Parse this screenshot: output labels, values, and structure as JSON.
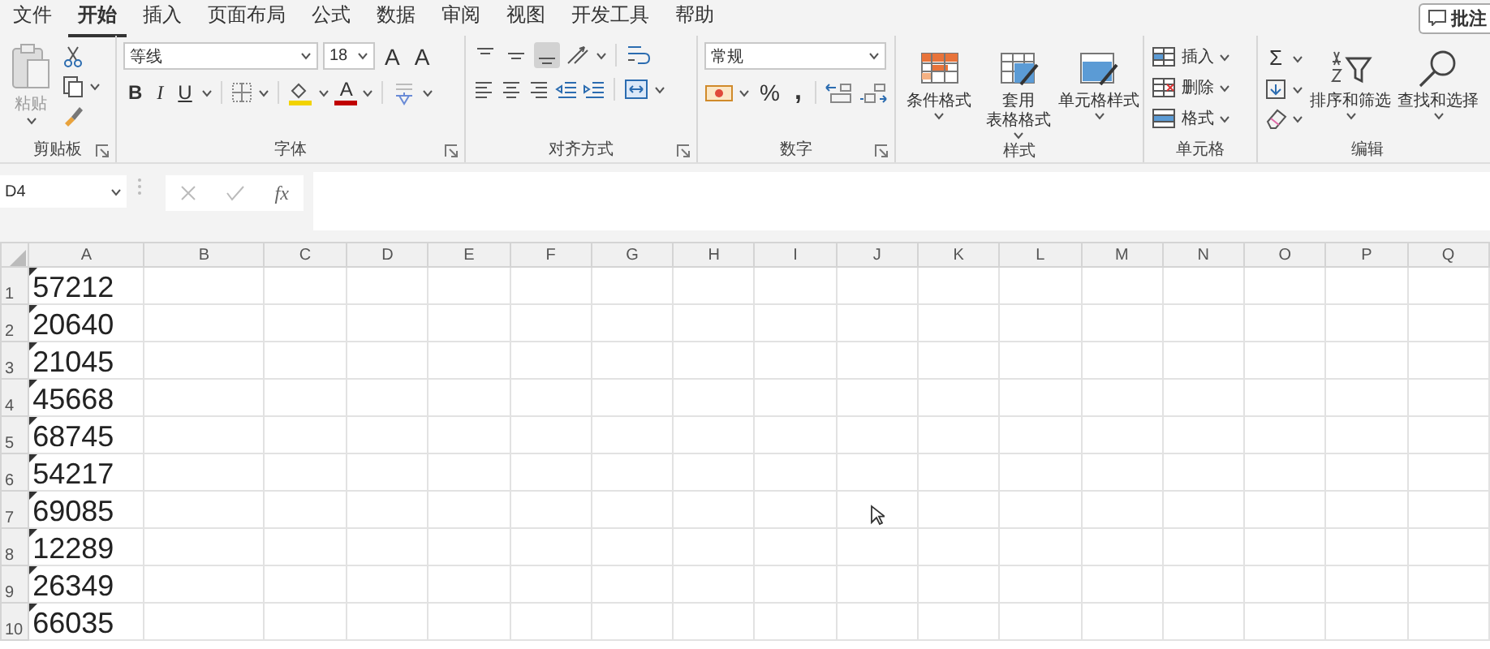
{
  "menu_tabs": [
    {
      "label": "文件",
      "selected": false
    },
    {
      "label": "开始",
      "selected": true
    },
    {
      "label": "插入",
      "selected": false
    },
    {
      "label": "页面布局",
      "selected": false
    },
    {
      "label": "公式",
      "selected": false
    },
    {
      "label": "数据",
      "selected": false
    },
    {
      "label": "审阅",
      "selected": false
    },
    {
      "label": "视图",
      "selected": false
    },
    {
      "label": "开发工具",
      "selected": false
    },
    {
      "label": "帮助",
      "selected": false
    }
  ],
  "comment_button": {
    "label": "批注"
  },
  "clipboard": {
    "label": "剪贴板",
    "paste": "粘贴"
  },
  "font": {
    "label": "字体",
    "font_name": "等线",
    "font_size": "18",
    "grow": "A",
    "shrink": "A",
    "bold": "B",
    "italic": "I",
    "underline": "U",
    "font_color": "A"
  },
  "alignment": {
    "label": "对齐方式",
    "vertical_align": [
      {
        "selected": false
      },
      {
        "selected": false
      },
      {
        "selected": true
      }
    ]
  },
  "number": {
    "label": "数字",
    "format": "常规",
    "percent": "%",
    "comma": ","
  },
  "styles": {
    "label": "样式",
    "buttons": [
      {
        "lines": [
          "条件格式"
        ]
      },
      {
        "lines": [
          "套用",
          "表格格式"
        ]
      },
      {
        "lines": [
          "单元格样式"
        ]
      }
    ]
  },
  "cells": {
    "label": "单元格",
    "buttons": [
      "插入",
      "删除",
      "格式"
    ]
  },
  "editing": {
    "label": "编辑",
    "sum": "Σ",
    "sort": "排序和筛选",
    "find": "查找和选择"
  },
  "formula_bar": {
    "name_box": "D4",
    "fx": "fx"
  },
  "sheet": {
    "columns": [
      "A",
      "B",
      "C",
      "D",
      "E",
      "F",
      "G",
      "H",
      "I",
      "J",
      "K",
      "L",
      "M",
      "N",
      "O",
      "P",
      "Q"
    ],
    "rows": [
      {
        "header": "1",
        "value": "57212",
        "flagged": true
      },
      {
        "header": "2",
        "value": "20640",
        "flagged": true
      },
      {
        "header": "3",
        "value": "21045",
        "flagged": true
      },
      {
        "header": "4",
        "value": "45668",
        "flagged": true
      },
      {
        "header": "5",
        "value": "68745",
        "flagged": true
      },
      {
        "header": "6",
        "value": "54217",
        "flagged": true
      },
      {
        "header": "7",
        "value": "69085",
        "flagged": true
      },
      {
        "header": "8",
        "value": "12289",
        "flagged": true
      },
      {
        "header": "9",
        "value": "26349",
        "flagged": true
      },
      {
        "header": "10",
        "value": "66035",
        "flagged": true
      }
    ]
  }
}
